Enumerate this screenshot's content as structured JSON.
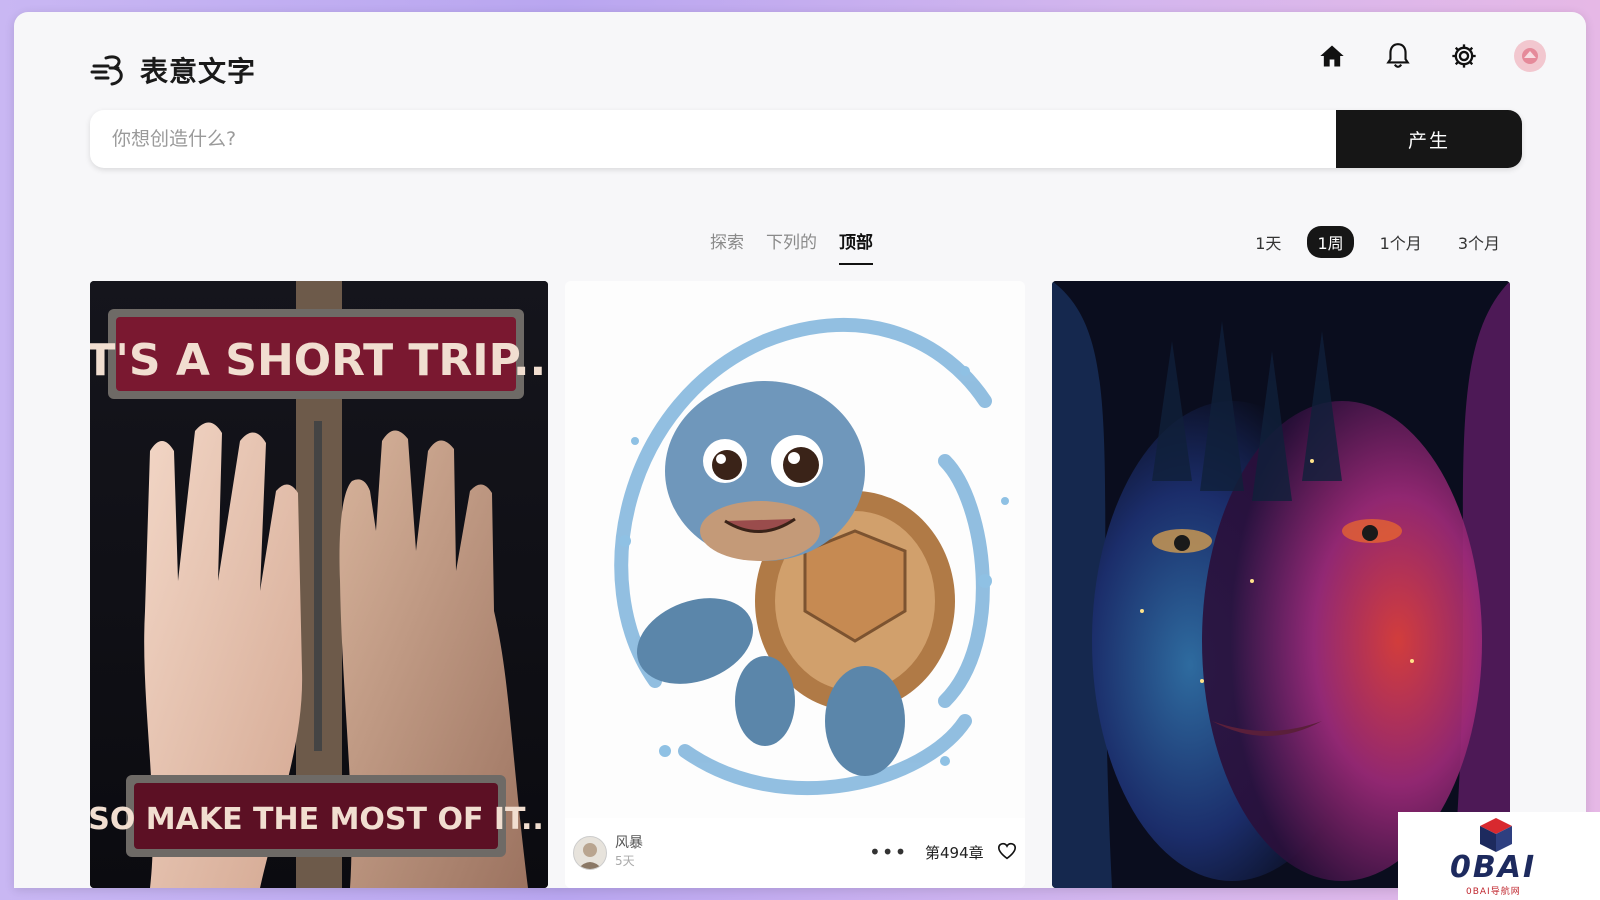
{
  "app": {
    "name": "表意文字"
  },
  "search": {
    "placeholder": "你想创造什么?",
    "generate_label": "产生"
  },
  "tabs": [
    {
      "label": "探索",
      "active": false
    },
    {
      "label": "下列的",
      "active": false
    },
    {
      "label": "顶部",
      "active": true
    }
  ],
  "periods": [
    {
      "label": "1天",
      "active": false
    },
    {
      "label": "1周",
      "active": true
    },
    {
      "label": "1个月",
      "active": false
    },
    {
      "label": "3个月",
      "active": false
    }
  ],
  "cards": [
    {
      "sign_top": "IT'S A SHORT TRIP...",
      "sign_bottom": "SO MAKE THE MOST OF IT.."
    },
    {
      "author": "风暴",
      "time": "5天",
      "count": "第494章",
      "more": "•••"
    },
    {}
  ],
  "watermark": {
    "text": "0BAI",
    "sub": "0BAI导航网"
  },
  "icons": [
    "logo-icon",
    "home-icon",
    "bell-icon",
    "gear-icon",
    "avatar-icon",
    "more-icon",
    "heart-icon"
  ]
}
